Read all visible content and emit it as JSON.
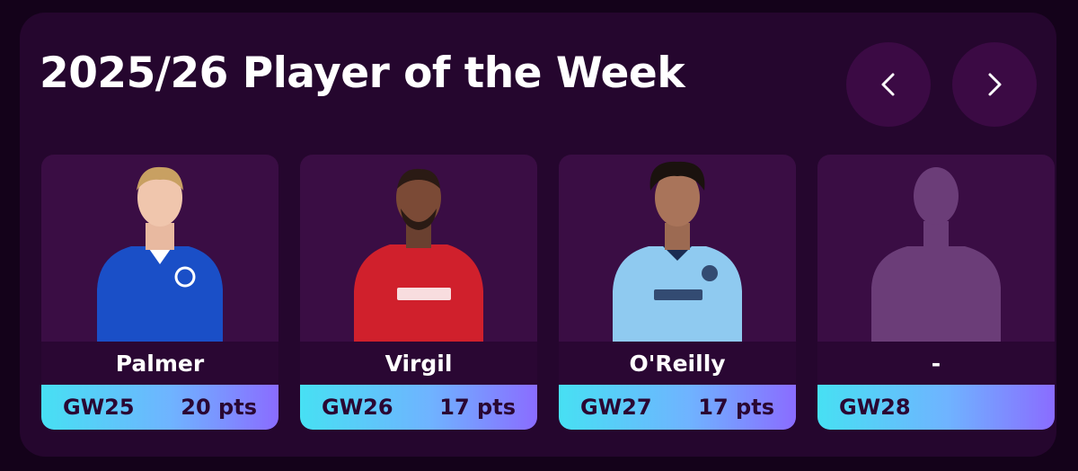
{
  "title": "2025/26 Player of the Week",
  "nav": {
    "prev_icon": "chevron-left-icon",
    "next_icon": "chevron-right-icon"
  },
  "cards": [
    {
      "name": "Palmer",
      "gw": "GW25",
      "pts": "20 pts",
      "kit": "#1a4fc7",
      "accent": "#ffffff"
    },
    {
      "name": "Virgil",
      "gw": "GW26",
      "pts": "17 pts",
      "kit": "#d0202c",
      "accent": "#ffffff"
    },
    {
      "name": "O'Reilly",
      "gw": "GW27",
      "pts": "17 pts",
      "kit": "#8fcaf0",
      "accent": "#1b2b52"
    },
    {
      "name": "-",
      "gw": "GW28",
      "pts": "",
      "kit": "#6b3d78",
      "accent": "#6b3d78"
    }
  ],
  "colors": {
    "background": "#14021a",
    "panel": "#25062e",
    "card": "#3a0d44",
    "name_bar": "#2a0733",
    "gradient_start": "#47e0f3",
    "gradient_end": "#8a6cff"
  }
}
